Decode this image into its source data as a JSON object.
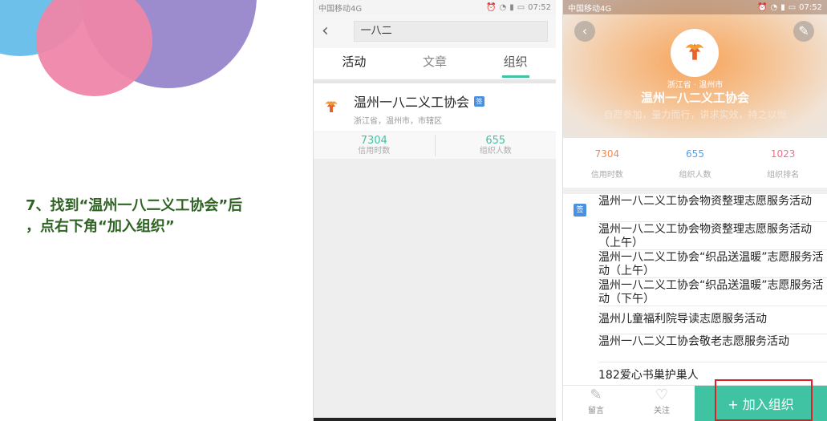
{
  "instruction": {
    "line1": "7、找到“温州一八二义工协会”后",
    "line2": "，点右下角“加入组织”"
  },
  "statusbar": {
    "carrier": "中国移动4G",
    "time": "07:52",
    "icons": [
      "alarm-icon",
      "hd-icon",
      "wifi-icon",
      "signal-icon",
      "battery-icon"
    ]
  },
  "search_screen": {
    "back_icon": "back-chevron-icon",
    "search_value": "一八二",
    "tabs": [
      "活动",
      "文章",
      "组织"
    ],
    "selected_tab": "组织",
    "result": {
      "name": "温州一八二义工协会",
      "badge": "签",
      "location": "浙江省，温州市，市辖区",
      "stats": [
        {
          "value": "7304",
          "label": "信用时数"
        },
        {
          "value": "655",
          "label": "组织人数"
        }
      ]
    }
  },
  "org_screen": {
    "region": "浙江省 · 温州市",
    "title": "温州一八二义工协会",
    "motto": "自愿参加，量力而行，讲求实效，持之以恒",
    "stats": [
      {
        "value": "7304",
        "label": "信用时数",
        "color": "#f08a4b"
      },
      {
        "value": "655",
        "label": "组织人数",
        "color": "#5a9ee6"
      },
      {
        "value": "1023",
        "label": "组织排名",
        "color": "#ef6f8a"
      }
    ],
    "sign_badge": "签",
    "activities": [
      "温州一八二义工协会物资整理志愿服务活动",
      "温州一八二义工协会物资整理志愿服务活动（上午）",
      "温州一八二义工协会“织品送温暖”志愿服务活动（上午）",
      "温州一八二义工协会“织品送温暖”志愿服务活动（下午）",
      "温州儿童福利院导读志愿服务活动",
      "温州一八二义工协会敬老志愿服务活动",
      "182爱心书巢护巢人"
    ],
    "bottom": {
      "comment_label": "留言",
      "follow_label": "关注",
      "join_label": "+ 加入组织"
    }
  },
  "colors": {
    "accent": "#3fc3a3",
    "highlight": "#d9232a",
    "instruction_text": "#2f6323"
  }
}
